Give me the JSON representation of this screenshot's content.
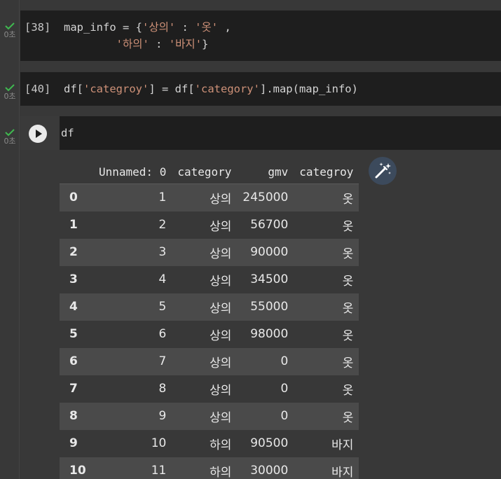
{
  "cells": [
    {
      "prompt": "[38]",
      "exec_time": "0초",
      "line1_pre": "map_info = {",
      "line1_s1": "'상의'",
      "line1_mid": " : ",
      "line1_s2": "'옷'",
      "line1_post": " ,",
      "line2_s1": "'하의'",
      "line2_mid": " : ",
      "line2_s2": "'바지'",
      "line2_post": "}"
    },
    {
      "prompt": "[40]",
      "exec_time": "0초",
      "p1": "df[",
      "s1": "'categroy'",
      "p2": "] = df[",
      "s2": "'category'",
      "p3": "].map(map_info)"
    },
    {
      "exec_time": "0초",
      "code": "df"
    }
  ],
  "dataframe": {
    "columns": [
      "Unnamed: 0",
      "category",
      "gmv",
      "categroy"
    ],
    "rows": [
      {
        "idx": "0",
        "c1": "1",
        "c2": "상의",
        "c3": "245000",
        "c4": "옷"
      },
      {
        "idx": "1",
        "c1": "2",
        "c2": "상의",
        "c3": "56700",
        "c4": "옷"
      },
      {
        "idx": "2",
        "c1": "3",
        "c2": "상의",
        "c3": "90000",
        "c4": "옷"
      },
      {
        "idx": "3",
        "c1": "4",
        "c2": "상의",
        "c3": "34500",
        "c4": "옷"
      },
      {
        "idx": "4",
        "c1": "5",
        "c2": "상의",
        "c3": "55000",
        "c4": "옷"
      },
      {
        "idx": "5",
        "c1": "6",
        "c2": "상의",
        "c3": "98000",
        "c4": "옷"
      },
      {
        "idx": "6",
        "c1": "7",
        "c2": "상의",
        "c3": "0",
        "c4": "옷"
      },
      {
        "idx": "7",
        "c1": "8",
        "c2": "상의",
        "c3": "0",
        "c4": "옷"
      },
      {
        "idx": "8",
        "c1": "9",
        "c2": "상의",
        "c3": "0",
        "c4": "옷"
      },
      {
        "idx": "9",
        "c1": "10",
        "c2": "하의",
        "c3": "90500",
        "c4": "바지"
      },
      {
        "idx": "10",
        "c1": "11",
        "c2": "하의",
        "c3": "30000",
        "c4": "바지"
      }
    ]
  },
  "icons": {
    "status": "check-icon",
    "run": "play-icon",
    "magic": "magic-wand-icon"
  },
  "colors": {
    "check": "#3fb950",
    "string": "#ce9178",
    "cell_bg": "#1e1e1e",
    "output_bg": "#383838"
  }
}
